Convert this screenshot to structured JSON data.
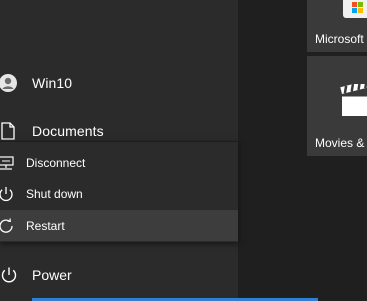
{
  "left_nav": {
    "user_label": "Win10",
    "documents_label": "Documents"
  },
  "power_menu": {
    "items": [
      {
        "label": "Disconnect",
        "icon": "disconnect-icon"
      },
      {
        "label": "Shut down",
        "icon": "power-icon"
      },
      {
        "label": "Restart",
        "icon": "restart-icon"
      }
    ],
    "highlighted": "Restart"
  },
  "power_button": {
    "label": "Power",
    "icon": "power-icon"
  },
  "tiles": [
    {
      "label": "Microsoft",
      "icon": "microsoft-store-icon"
    },
    {
      "label": "Movies &",
      "icon": "clapperboard-icon"
    }
  ],
  "colors": {
    "menu_bg": "#2b2b2b",
    "desktop_bg": "#1f1f1f",
    "tile_bg": "#3a3a3a",
    "hover_bg": "#3d3d3d",
    "accent": "#2f7fd6"
  }
}
